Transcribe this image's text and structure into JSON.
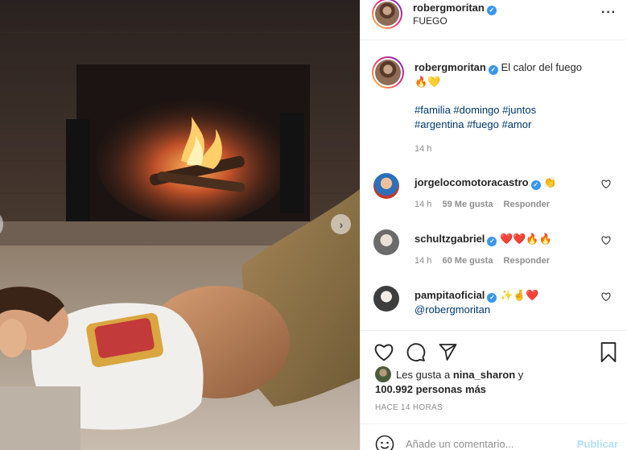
{
  "post": {
    "author": "robergmoritan",
    "location": "FUEGO",
    "caption": "El calor del fuego",
    "caption_emoji": "🔥💛",
    "hashtags": [
      "#familia",
      "#domingo",
      "#juntos",
      "#argentina",
      "#fuego",
      "#amor"
    ],
    "time": "14 h"
  },
  "comments": [
    {
      "user": "jorgelocomotoracastro",
      "text": "👏",
      "time": "14 h",
      "likes": "59 Me gusta",
      "reply": "Responder"
    },
    {
      "user": "schultzgabriel",
      "text": "❤️❤️🔥🔥",
      "time": "14 h",
      "likes": "60 Me gusta",
      "reply": "Responder"
    },
    {
      "user": "pampitaoficial",
      "text": "✨🤞❤️",
      "mention": "@robergmoritan"
    }
  ],
  "likes": {
    "prefix": "Les gusta a",
    "first_user": "nina_sharon",
    "joiner": "y",
    "count": "100.992 personas más"
  },
  "posted_ago": "HACE 14 HORAS",
  "add_comment": {
    "placeholder": "Añade un comentario...",
    "publish": "Publicar"
  },
  "icons": {
    "more": "more-dots-icon",
    "like": "heart-icon",
    "comment": "comment-bubble-icon",
    "share": "paper-plane-icon",
    "save": "bookmark-icon",
    "emoji": "smiley-icon",
    "next": "chevron-right-icon"
  },
  "colors": {
    "verified": "#3897f0",
    "link": "#00376b",
    "muted": "#8e8e8e",
    "publish_disabled": "#b2dffc"
  }
}
